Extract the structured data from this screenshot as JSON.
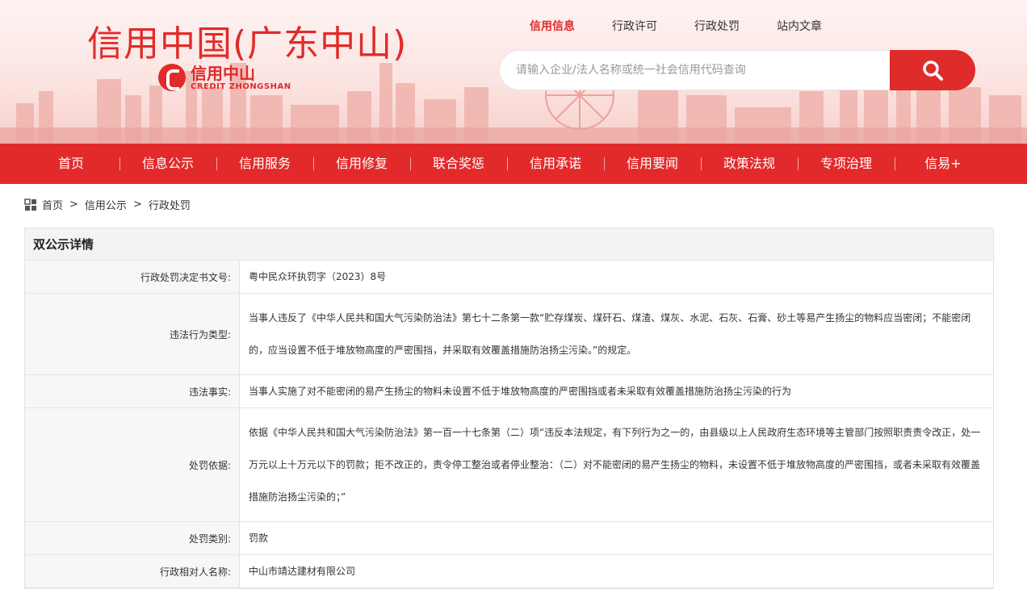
{
  "header": {
    "site_title": "信用中国(广东中山)",
    "logo_cn": "信用中山",
    "logo_en": "CREDIT ZHONGSHAN",
    "top_nav": [
      "信用信息",
      "行政许可",
      "行政处罚",
      "站内文章"
    ],
    "top_nav_active": 0,
    "search_placeholder": "请输入企业/法人名称或统一社会信用代码查询",
    "search_icon": "search-icon"
  },
  "main_nav": [
    "首页",
    "信息公示",
    "信用服务",
    "信用修复",
    "联合奖惩",
    "信用承诺",
    "信用要闻",
    "政策法规",
    "专项治理",
    "信易+"
  ],
  "breadcrumb": [
    "首页",
    "信用公示",
    "行政处罚"
  ],
  "breadcrumb_separator": ">",
  "detail": {
    "title": "双公示详情",
    "rows": [
      {
        "label": "行政处罚决定书文号:",
        "value": "粤中民众环执罚字（2023）8号"
      },
      {
        "label": "违法行为类型:",
        "value": "当事人违反了《中华人民共和国大气污染防治法》第七十二条第一款“贮存煤炭、煤矸石、煤渣、煤灰、水泥、石灰、石膏、砂土等易产生扬尘的物料应当密闭；不能密闭的，应当设置不低于堆放物高度的严密围挡，并采取有效覆盖措施防治扬尘污染。”的规定。"
      },
      {
        "label": "违法事实:",
        "value": "当事人实施了对不能密闭的易产生扬尘的物料未设置不低于堆放物高度的严密围挡或者未采取有效覆盖措施防治扬尘污染的行为"
      },
      {
        "label": "处罚依据:",
        "value": "依据《中华人民共和国大气污染防治法》第一百一十七条第（二）项“违反本法规定，有下列行为之一的，由县级以上人民政府生态环境等主管部门按照职责责令改正，处一万元以上十万元以下的罚款；拒不改正的，责令停工整治或者停业整治：（二）对不能密闭的易产生扬尘的物料，未设置不低于堆放物高度的严密围挡，或者未采取有效覆盖措施防治扬尘污染的；”"
      },
      {
        "label": "处罚类别:",
        "value": "罚款"
      },
      {
        "label": "行政相对人名称:",
        "value": "中山市靖达建材有限公司"
      }
    ]
  },
  "colors": {
    "brand_red": "#e22a2a",
    "title_red": "#e02b2b"
  }
}
